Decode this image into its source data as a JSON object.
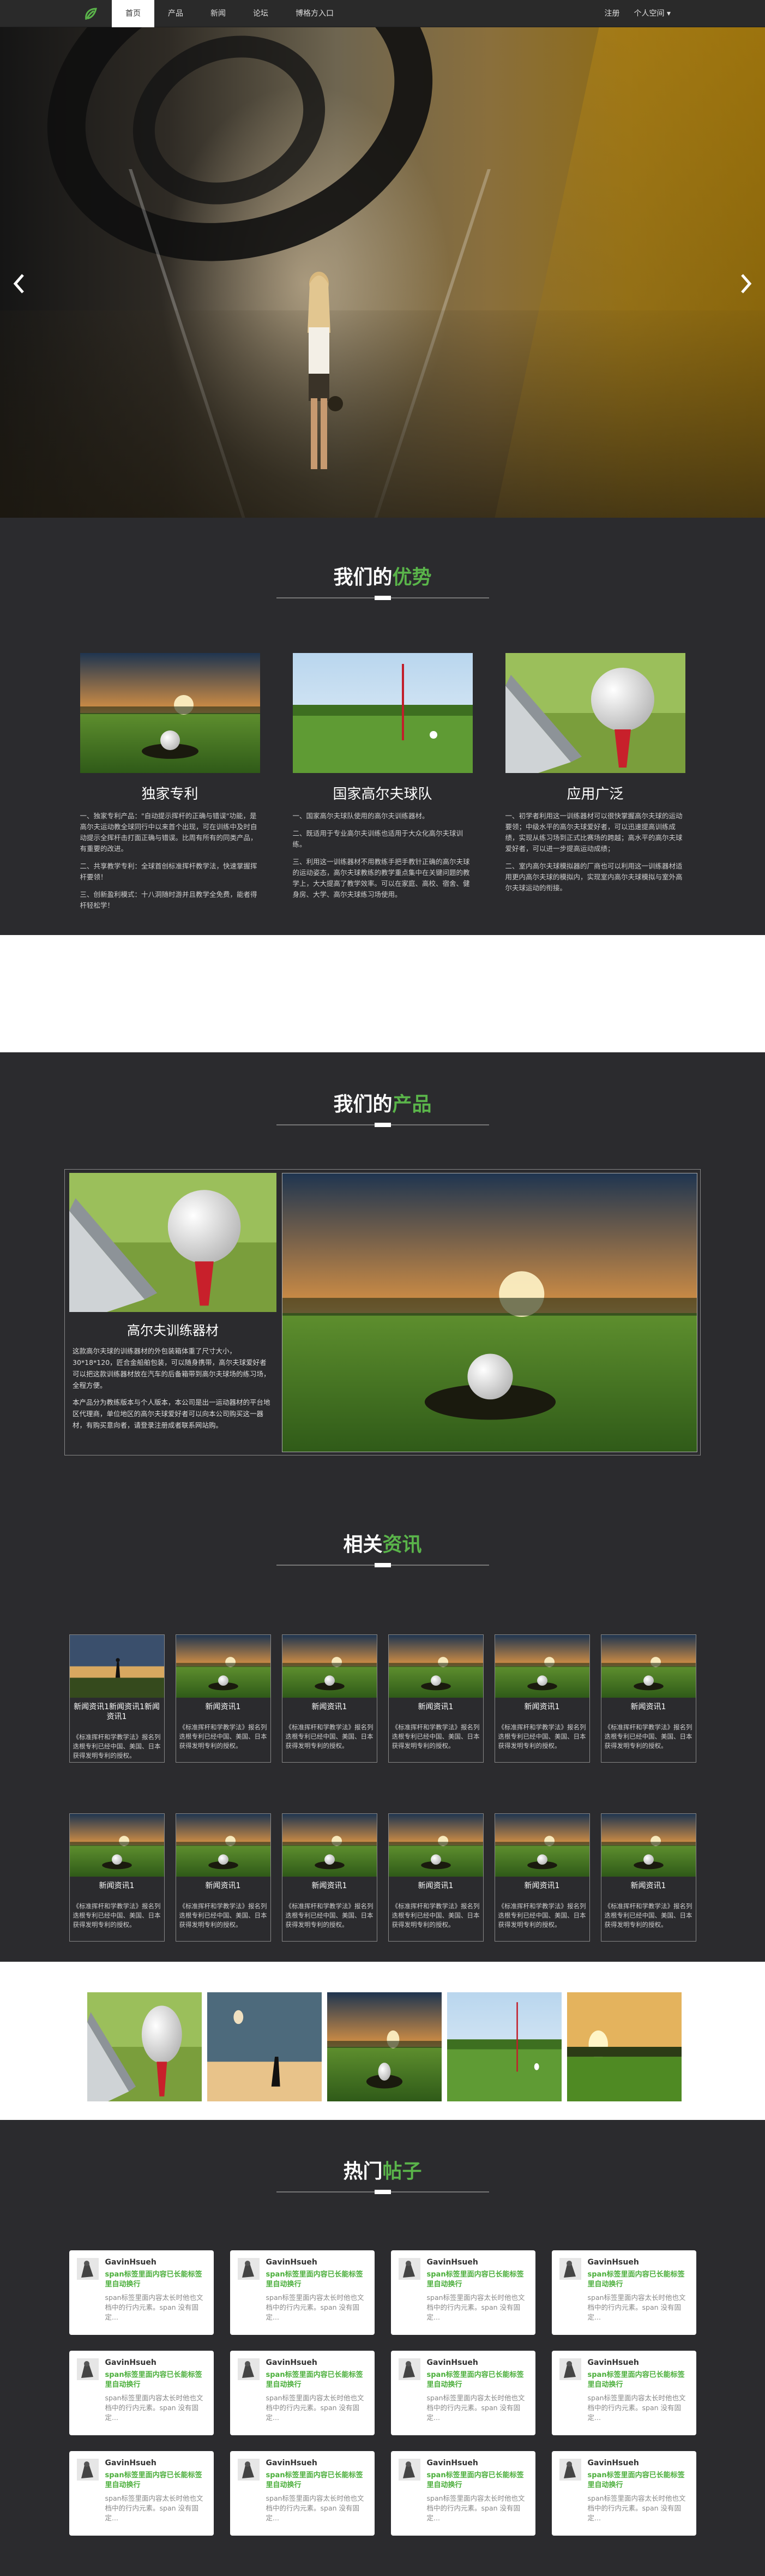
{
  "nav": {
    "left": [
      {
        "label": "首页",
        "active": true
      },
      {
        "label": "产品",
        "active": false
      },
      {
        "label": "新闻",
        "active": false
      },
      {
        "label": "论坛",
        "active": false
      },
      {
        "label": "博格方入口",
        "active": false
      }
    ],
    "right": [
      {
        "label": "注册"
      },
      {
        "label": "个人空间 ▾"
      }
    ]
  },
  "hero": {
    "slide_count": 6,
    "active_slide": 1
  },
  "advantages": {
    "title_plain": "我们的",
    "title_highlight": "优势",
    "items": [
      {
        "heading": "独家专利",
        "paragraphs": [
          "一、独家专利产品：\"自动提示挥杆的正确与错误\"功能，是高尔夫运动教全球同行中以来首个出现，可在训练中及时自动提示全挥杆击打面正确与错误。比周有所有的同类产品，有重要的改进。",
          "二、共享教学专利：全球首创标准挥杆教学法，快速掌握挥杆要领！",
          "三、创新盈利模式：十八洞随时游并且教学全免费，能者得杆轻松学！"
        ]
      },
      {
        "heading": "国家高尔夫球队",
        "paragraphs": [
          "一、国家高尔夫球队使用的高尔夫训练器材。",
          "二、既适用于专业高尔夫训练也适用于大众化高尔夫球训练。",
          "三、利用这一训练器材不用教练手把手教针正确的高尔夫球的运动姿态，高尔夫球教练的教学重点集中在关键问题的教学上，大大提高了教学效率。可以在家庭、高校、宿舍、健身房、大学、高尔夫球练习场使用。"
        ]
      },
      {
        "heading": "应用广泛",
        "paragraphs": [
          "一、初学者利用这一训练器材可以很快掌握高尔夫球的运动要领；中级水平的高尔夫球爱好者，可以迅速提高训练成绩，实现从练习场到正式比赛场的跨越；高水平的高尔夫球爱好者，可以进一步提高运动成绩；",
          "二、室内高尔夫球模拟器的厂商也可以利用这一训练器材适用更内高尔夫球的模拟内，实现室内高尔夫球模拟与室外高尔夫球运动的衔接。"
        ]
      }
    ]
  },
  "products": {
    "title_plain": "我们的",
    "title_highlight": "产品",
    "card": {
      "heading": "高尔夫训练器材",
      "paragraphs": [
        "这款高尔夫球的训练器材的外包装箱体重了尺寸大小，30*18*120，匠合金船舶包装，可以随身携带，高尔夫球爱好者可以把这款训练器材放在汽车的后备箱带到高尔夫球场的练习场，全程方便。",
        "本产品分为教练版本与个人版本，本公司是出一运动器材的平台地区代理商，单位地区的高尔夫球爱好者可以向本公司购买这一器材，有购买意向者，请登录注册成者联系网站购。"
      ]
    }
  },
  "news": {
    "title_plain": "相关",
    "title_highlight": "资讯",
    "items": [
      {
        "title": "新闻资讯1新闻资讯1新闻资讯1",
        "summary": "《标准挥杆和学教学法》报名列迭根专利已经中国、美国、日本获得发明专利的授权。"
      },
      {
        "title": "新闻资讯1",
        "summary": "《标准挥杆和学教学法》报名列迭根专利已经中国、美国、日本获得发明专利的授权。"
      },
      {
        "title": "新闻资讯1",
        "summary": "《标准挥杆和学教学法》报名列迭根专利已经中国、美国、日本获得发明专利的授权。"
      },
      {
        "title": "新闻资讯1",
        "summary": "《标准挥杆和学教学法》报名列迭根专利已经中国、美国、日本获得发明专利的授权。"
      },
      {
        "title": "新闻资讯1",
        "summary": "《标准挥杆和学教学法》报名列迭根专利已经中国、美国、日本获得发明专利的授权。"
      },
      {
        "title": "新闻资讯1",
        "summary": "《标准挥杆和学教学法》报名列迭根专利已经中国、美国、日本获得发明专利的授权。"
      },
      {
        "title": "新闻资讯1",
        "summary": "《标准挥杆和学教学法》报名列迭根专利已经中国、美国、日本获得发明专利的授权。"
      },
      {
        "title": "新闻资讯1",
        "summary": "《标准挥杆和学教学法》报名列迭根专利已经中国、美国、日本获得发明专利的授权。"
      },
      {
        "title": "新闻资讯1",
        "summary": "《标准挥杆和学教学法》报名列迭根专利已经中国、美国、日本获得发明专利的授权。"
      },
      {
        "title": "新闻资讯1",
        "summary": "《标准挥杆和学教学法》报名列迭根专利已经中国、美国、日本获得发明专利的授权。"
      },
      {
        "title": "新闻资讯1",
        "summary": "《标准挥杆和学教学法》报名列迭根专利已经中国、美国、日本获得发明专利的授权。"
      },
      {
        "title": "新闻资讯1",
        "summary": "《标准挥杆和学教学法》报名列迭根专利已经中国、美国、日本获得发明专利的授权。"
      }
    ]
  },
  "hot_posts": {
    "title_plain": "热门",
    "title_highlight": "帖子",
    "items": [
      {
        "user": "GavinHsueh",
        "title": "span标签里面内容已长能标签里自动换行",
        "body": "span标签里面内容太长时他也文档中的行内元素。span 没有固定..."
      },
      {
        "user": "GavinHsueh",
        "title": "span标签里面内容已长能标签里自动换行",
        "body": "span标签里面内容太长时他也文档中的行内元素。span 没有固定..."
      },
      {
        "user": "GavinHsueh",
        "title": "span标签里面内容已长能标签里自动换行",
        "body": "span标签里面内容太长时他也文档中的行内元素。span 没有固定..."
      },
      {
        "user": "GavinHsueh",
        "title": "span标签里面内容已长能标签里自动换行",
        "body": "span标签里面内容太长时他也文档中的行内元素。span 没有固定..."
      },
      {
        "user": "GavinHsueh",
        "title": "span标签里面内容已长能标签里自动换行",
        "body": "span标签里面内容太长时他也文档中的行内元素。span 没有固定..."
      },
      {
        "user": "GavinHsueh",
        "title": "span标签里面内容已长能标签里自动换行",
        "body": "span标签里面内容太长时他也文档中的行内元素。span 没有固定..."
      },
      {
        "user": "GavinHsueh",
        "title": "span标签里面内容已长能标签里自动换行",
        "body": "span标签里面内容太长时他也文档中的行内元素。span 没有固定..."
      },
      {
        "user": "GavinHsueh",
        "title": "span标签里面内容已长能标签里自动换行",
        "body": "span标签里面内容太长时他也文档中的行内元素。span 没有固定..."
      },
      {
        "user": "GavinHsueh",
        "title": "span标签里面内容已长能标签里自动换行",
        "body": "span标签里面内容太长时他也文档中的行内元素。span 没有固定..."
      },
      {
        "user": "GavinHsueh",
        "title": "span标签里面内容已长能标签里自动换行",
        "body": "span标签里面内容太长时他也文档中的行内元素。span 没有固定..."
      },
      {
        "user": "GavinHsueh",
        "title": "span标签里面内容已长能标签里自动换行",
        "body": "span标签里面内容太长时他也文档中的行内元素。span 没有固定..."
      },
      {
        "user": "GavinHsueh",
        "title": "span标签里面内容已长能标签里自动换行",
        "body": "span标签里面内容太长时他也文档中的行内元素。span 没有固定..."
      }
    ]
  },
  "colors": {
    "accent": "#5ab44a",
    "nav_bg": "#2a2a2a",
    "section_bg": "#2b2b2e",
    "post_title": "#4caf3c"
  },
  "icons": {
    "logo": "leaf-logo-icon",
    "prev": "chevron-left-icon",
    "next": "chevron-right-icon"
  }
}
